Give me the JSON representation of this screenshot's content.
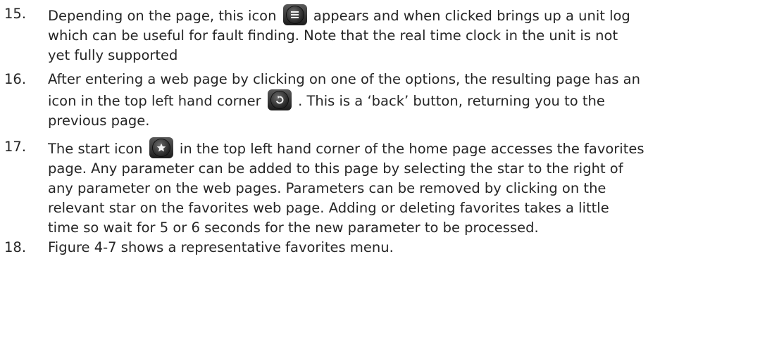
{
  "items": [
    {
      "number": "15.",
      "lines": [
        {
          "pre": "Depending on the page, this icon",
          "post": "appears and when clicked brings up a unit log"
        },
        "which can be useful for fault finding. Note that the real time clock in the unit is not",
        "yet fully supported"
      ],
      "icon": "menu-icon"
    },
    {
      "number": "16.",
      "lines": [
        "After entering a web page by clicking on one of the options, the resulting page has an",
        {
          "pre": "icon in the top left hand corner",
          "post": ". This is a ‘back’ button, returning you to the"
        },
        "previous page."
      ],
      "icon": "back-arrow-icon"
    },
    {
      "number": "17.",
      "lines": [
        {
          "pre": "The start icon",
          "post": "in the top left hand corner of the home page accesses the favorites"
        },
        "page. Any parameter can be added to this page by selecting the star to the right of",
        "any parameter on the web pages. Parameters can be removed by clicking on the",
        "relevant star on the favorites web page. Adding or deleting favorites takes a little",
        "time so wait for 5 or 6 seconds for the new parameter to be processed."
      ],
      "icon": "star-icon"
    },
    {
      "number": "18.",
      "lines": [
        "Figure 4-7 shows a representative favorites menu."
      ]
    }
  ],
  "colors": {
    "text": "#262626",
    "icon_dark": "#1c1c1c",
    "icon_glyph": "#f2f2f2"
  }
}
